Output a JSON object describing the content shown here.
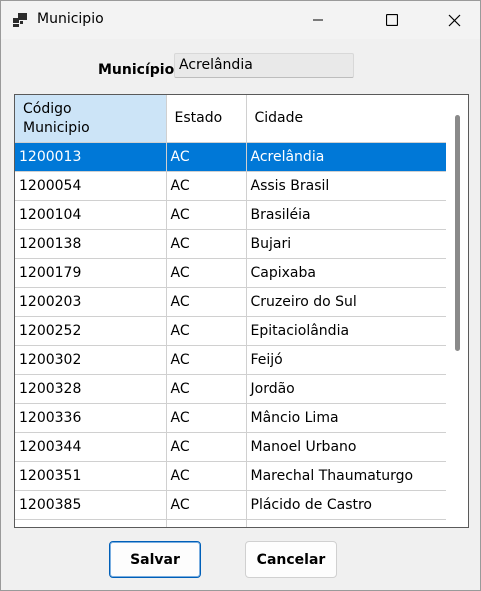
{
  "window": {
    "title": "Municipio"
  },
  "form": {
    "label": "Município",
    "value": "Acrelândia"
  },
  "grid": {
    "columns": [
      "Código\nMunicipio",
      "Estado",
      "Cidade"
    ],
    "rows": [
      [
        "1200013",
        "AC",
        "Acrelândia"
      ],
      [
        "1200054",
        "AC",
        "Assis Brasil"
      ],
      [
        "1200104",
        "AC",
        "Brasiléia"
      ],
      [
        "1200138",
        "AC",
        "Bujari"
      ],
      [
        "1200179",
        "AC",
        "Capixaba"
      ],
      [
        "1200203",
        "AC",
        "Cruzeiro do Sul"
      ],
      [
        "1200252",
        "AC",
        "Epitaciolândia"
      ],
      [
        "1200302",
        "AC",
        "Feijó"
      ],
      [
        "1200328",
        "AC",
        "Jordão"
      ],
      [
        "1200336",
        "AC",
        "Mâncio Lima"
      ],
      [
        "1200344",
        "AC",
        "Manoel Urbano"
      ],
      [
        "1200351",
        "AC",
        "Marechal Thaumaturgo"
      ],
      [
        "1200385",
        "AC",
        "Plácido de Castro"
      ],
      [
        "",
        "",
        ""
      ]
    ],
    "selected_row": 0
  },
  "buttons": {
    "save": "Salvar",
    "cancel": "Cancelar"
  },
  "colors": {
    "selection": "#0078d7",
    "header_selected": "#cce4f7"
  }
}
